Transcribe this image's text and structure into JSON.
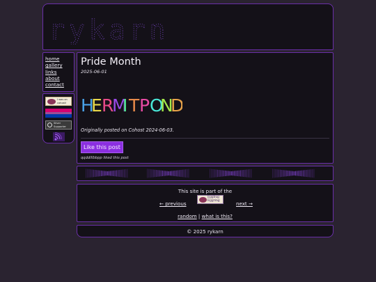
{
  "site": {
    "logo_text": "rykarn"
  },
  "nav": {
    "items": [
      "home",
      "gallery",
      "links",
      "about",
      "contact"
    ]
  },
  "badges": {
    "cohost_text": "I was on cohost!",
    "silver_text": "Silver Supporter",
    "rss": "rss-icon"
  },
  "post": {
    "title": "Pride Month",
    "date": "2025-06-01",
    "image_text": "HERMITPOND",
    "image_colors": [
      "#4aa3e8",
      "#e8d84a",
      "#e84a8a",
      "#9a4ae8",
      "#4ae88a",
      "#e88a4a",
      "#e84aa3",
      "#4ae8d8",
      "#a3e84a",
      "#e8a34a"
    ],
    "note": "Originally posted on Cohost 2024-06-03.",
    "like_label": "Like this post",
    "liked_by": "qqddlllbbpp liked this post"
  },
  "webring": {
    "intro": "This site is part of the",
    "banner_text": "Eggbug Eggring",
    "prev": "← previous",
    "next": "next →",
    "random": "random",
    "separator": "|",
    "what": "what is this?"
  },
  "footer": {
    "copyright": "© 2025 rykarn"
  },
  "colors": {
    "accent": "#8b2fe0",
    "border": "#6a2fa8",
    "background": "#2a2330",
    "panel": "#141118"
  }
}
